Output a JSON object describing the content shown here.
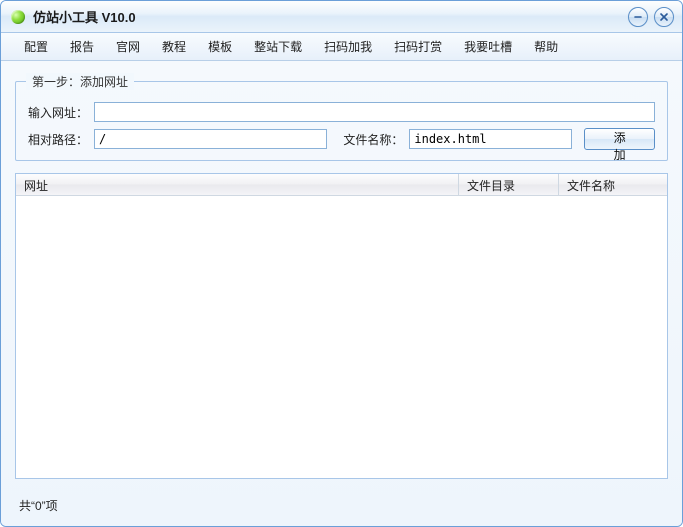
{
  "window": {
    "title": "仿站小工具 V10.0"
  },
  "menu": {
    "items": [
      "配置",
      "报告",
      "官网",
      "教程",
      "模板",
      "整站下载",
      "扫码加我",
      "扫码打赏",
      "我要吐槽",
      "帮助"
    ]
  },
  "step1": {
    "legend": "第一步：添加网址",
    "url_label": "输入网址：",
    "url_value": "",
    "path_label": "相对路径：",
    "path_value": "/",
    "filename_label": "文件名称：",
    "filename_value": "index.html",
    "add_button": "添加"
  },
  "table": {
    "headers": {
      "url": "网址",
      "dir": "文件目录",
      "name": "文件名称"
    },
    "rows": []
  },
  "footer": {
    "count_text": "共“0”项"
  }
}
